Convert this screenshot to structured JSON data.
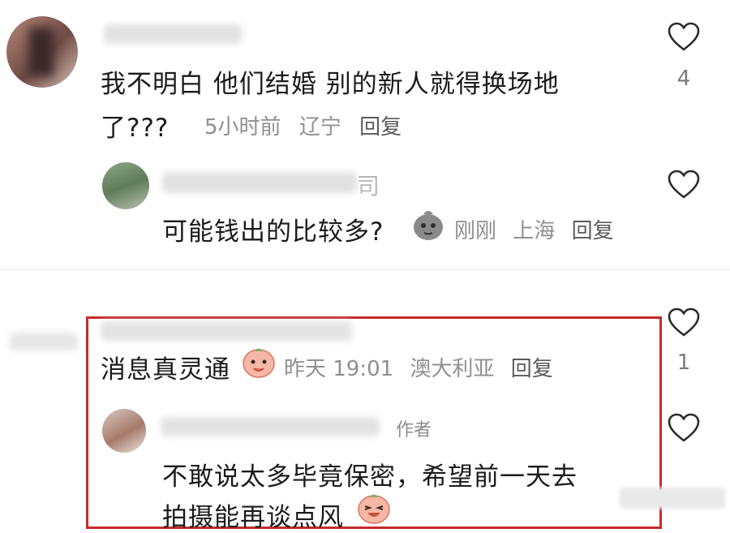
{
  "comments": [
    {
      "text_line1": "我不明白 他们结婚 别的新人就得换场地",
      "text_line2": "了???",
      "time": "5小时前",
      "location": "辽宁",
      "reply_label": "回复",
      "like_count": "4",
      "replies": [
        {
          "text": "可能钱出的比较多?",
          "time": "刚刚",
          "location": "上海",
          "reply_label": "回复",
          "username_fragment": "司"
        }
      ]
    },
    {
      "text": "消息真灵通",
      "time": "昨天 19:01",
      "location": "澳大利亚",
      "reply_label": "回复",
      "like_count": "1",
      "replies": [
        {
          "author_tag": "作者",
          "text_line1": "不敢说太多毕竟保密，希望前一天去",
          "text_line2": "拍摄能再谈点风"
        }
      ]
    }
  ],
  "colors": {
    "highlight_border": "#c62a2a",
    "meta_text": "#8f8f8f",
    "heart_stroke": "#2b2b2b"
  },
  "icons": {
    "like": "heart-outline-icon",
    "emoji_peach": "peach-sticker-icon",
    "emoji_grey": "grey-sticker-icon"
  }
}
